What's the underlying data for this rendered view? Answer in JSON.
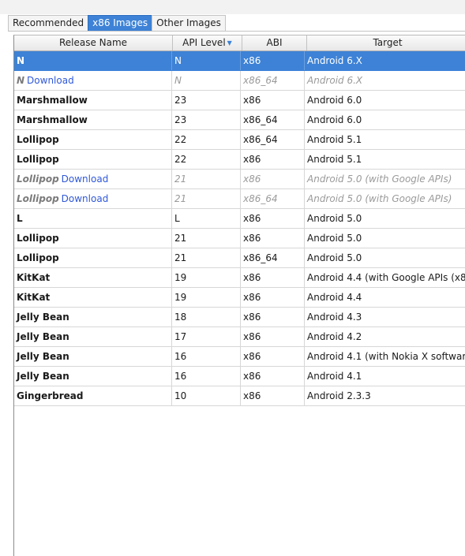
{
  "tabs": [
    {
      "label": "Recommended",
      "active": false
    },
    {
      "label": "x86 Images",
      "active": true
    },
    {
      "label": "Other Images",
      "active": false
    }
  ],
  "table": {
    "columns": [
      "Release Name",
      "API Level",
      "ABI",
      "Target"
    ],
    "sort_indicator": "▼",
    "rows": [
      {
        "name": "N",
        "download": "",
        "api": "N",
        "abi": "x86",
        "target": "Android 6.X",
        "selected": true,
        "dim": false
      },
      {
        "name": "N",
        "download": "Download",
        "api": "N",
        "abi": "x86_64",
        "target": "Android 6.X",
        "selected": false,
        "dim": true
      },
      {
        "name": "Marshmallow",
        "download": "",
        "api": "23",
        "abi": "x86",
        "target": "Android 6.0",
        "selected": false,
        "dim": false
      },
      {
        "name": "Marshmallow",
        "download": "",
        "api": "23",
        "abi": "x86_64",
        "target": "Android 6.0",
        "selected": false,
        "dim": false
      },
      {
        "name": "Lollipop",
        "download": "",
        "api": "22",
        "abi": "x86_64",
        "target": "Android 5.1",
        "selected": false,
        "dim": false
      },
      {
        "name": "Lollipop",
        "download": "",
        "api": "22",
        "abi": "x86",
        "target": "Android 5.1",
        "selected": false,
        "dim": false
      },
      {
        "name": "Lollipop",
        "download": "Download",
        "api": "21",
        "abi": "x86",
        "target": "Android 5.0 (with Google APIs)",
        "selected": false,
        "dim": true
      },
      {
        "name": "Lollipop",
        "download": "Download",
        "api": "21",
        "abi": "x86_64",
        "target": "Android 5.0 (with Google APIs)",
        "selected": false,
        "dim": true
      },
      {
        "name": "L",
        "download": "",
        "api": "L",
        "abi": "x86",
        "target": "Android 5.0",
        "selected": false,
        "dim": false
      },
      {
        "name": "Lollipop",
        "download": "",
        "api": "21",
        "abi": "x86",
        "target": "Android 5.0",
        "selected": false,
        "dim": false
      },
      {
        "name": "Lollipop",
        "download": "",
        "api": "21",
        "abi": "x86_64",
        "target": "Android 5.0",
        "selected": false,
        "dim": false
      },
      {
        "name": "KitKat",
        "download": "",
        "api": "19",
        "abi": "x86",
        "target": "Android 4.4 (with Google APIs (x8",
        "selected": false,
        "dim": false
      },
      {
        "name": "KitKat",
        "download": "",
        "api": "19",
        "abi": "x86",
        "target": "Android 4.4",
        "selected": false,
        "dim": false
      },
      {
        "name": "Jelly Bean",
        "download": "",
        "api": "18",
        "abi": "x86",
        "target": "Android 4.3",
        "selected": false,
        "dim": false
      },
      {
        "name": "Jelly Bean",
        "download": "",
        "api": "17",
        "abi": "x86",
        "target": "Android 4.2",
        "selected": false,
        "dim": false
      },
      {
        "name": "Jelly Bean",
        "download": "",
        "api": "16",
        "abi": "x86",
        "target": "Android 4.1 (with Nokia X softwar",
        "selected": false,
        "dim": false
      },
      {
        "name": "Jelly Bean",
        "download": "",
        "api": "16",
        "abi": "x86",
        "target": "Android 4.1",
        "selected": false,
        "dim": false
      },
      {
        "name": "Gingerbread",
        "download": "",
        "api": "10",
        "abi": "x86",
        "target": "Android 2.3.3",
        "selected": false,
        "dim": false
      }
    ]
  }
}
